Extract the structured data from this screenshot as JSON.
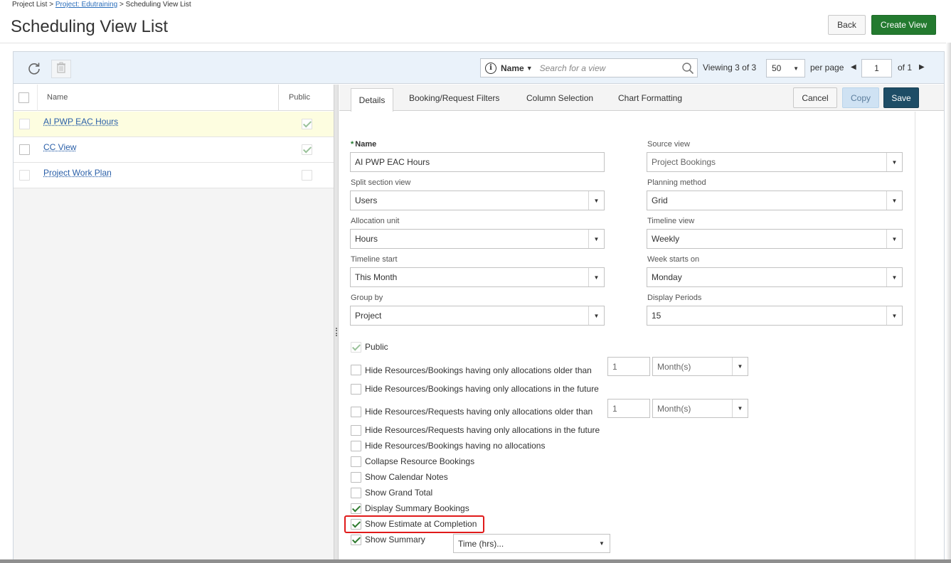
{
  "breadcrumb": {
    "item1": "Project List",
    "sep": ">",
    "item2": "Project: Edutraining",
    "item3": "Scheduling View List"
  },
  "page_title": "Scheduling View List",
  "header_buttons": {
    "back": "Back",
    "create": "Create View"
  },
  "toolbar": {
    "search_field": "Name",
    "search_placeholder": "Search for a view",
    "viewing_prefix": "Viewing",
    "viewing_count": "3 of 3",
    "per_page_value": "50",
    "per_page_label": "per page",
    "page_value": "1",
    "page_of": "of 1"
  },
  "list": {
    "columns": {
      "name": "Name",
      "public": "Public"
    },
    "rows": [
      {
        "name": "AI PWP EAC Hours",
        "public": true,
        "selected": true
      },
      {
        "name": "CC View",
        "public": true,
        "selected": false
      },
      {
        "name": "Project Work Plan",
        "public": false,
        "selected": false
      }
    ]
  },
  "tabs": [
    "Details",
    "Booking/Request Filters",
    "Column Selection",
    "Chart Formatting"
  ],
  "actions": {
    "cancel": "Cancel",
    "copy": "Copy",
    "save": "Save"
  },
  "form": {
    "name_label": "Name",
    "name_required_mark": "*",
    "name_value": "AI PWP EAC Hours",
    "source_view_label": "Source view",
    "source_view_value": "Project Bookings",
    "split_label": "Split section view",
    "split_value": "Users",
    "planning_label": "Planning method",
    "planning_value": "Grid",
    "alloc_label": "Allocation unit",
    "alloc_value": "Hours",
    "timeline_view_label": "Timeline view",
    "timeline_view_value": "Weekly",
    "timeline_start_label": "Timeline start",
    "timeline_start_value": "This Month",
    "week_starts_label": "Week starts on",
    "week_starts_value": "Monday",
    "group_by_label": "Group by",
    "group_by_value": "Project",
    "display_periods_label": "Display Periods",
    "display_periods_value": "15"
  },
  "options": {
    "public": "Public",
    "hide_bookings_older": "Hide Resources/Bookings having only allocations older than",
    "hide_bookings_older_qty": "1",
    "hide_bookings_older_unit": "Month(s)",
    "hide_bookings_future": "Hide Resources/Bookings having only allocations in the future",
    "hide_requests_older": "Hide Resources/Requests having only allocations older than",
    "hide_requests_older_qty": "1",
    "hide_requests_older_unit": "Month(s)",
    "hide_requests_future": "Hide Resources/Requests having only allocations in the future",
    "hide_no_alloc": "Hide Resources/Bookings having no allocations",
    "collapse": "Collapse Resource Bookings",
    "calendar_notes": "Show Calendar Notes",
    "grand_total": "Show Grand Total",
    "display_summary": "Display Summary Bookings",
    "show_eac": "Show Estimate at Completion",
    "show_summary": "Show Summary",
    "summary_select": "Time (hrs)..."
  },
  "colors": {
    "create_button": "#237a2f",
    "save_button": "#1e4d66",
    "highlight": "#e01a1a",
    "link": "#2a5fa8"
  }
}
